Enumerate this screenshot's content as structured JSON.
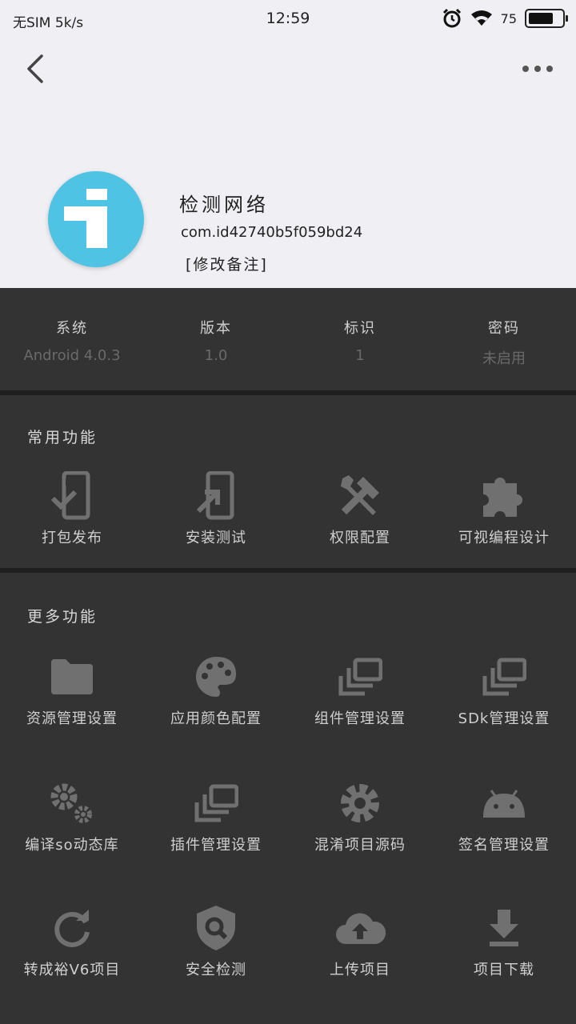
{
  "status_bar": {
    "carrier": "无SIM 5k/s",
    "time": "12:59",
    "battery_text": "75",
    "battery_level": 0.75
  },
  "header": {
    "back_icon": "back-arrow-icon",
    "more_icon": "more-horizontal-icon"
  },
  "app": {
    "icon": "info-icon",
    "icon_color": "#4fc3e3",
    "name": "检测网络",
    "package": "com.id42740b5f059bd24",
    "note_link": "[修改备注]"
  },
  "info": [
    {
      "label": "系统",
      "value": "Android 4.0.3"
    },
    {
      "label": "版本",
      "value": "1.0"
    },
    {
      "label": "标识",
      "value": "1"
    },
    {
      "label": "密码",
      "value": "未启用"
    }
  ],
  "common": {
    "title": "常用功能",
    "items": [
      {
        "label": "打包发布",
        "icon": "phone-check-icon"
      },
      {
        "label": "安装测试",
        "icon": "phone-install-icon"
      },
      {
        "label": "权限配置",
        "icon": "tools-icon"
      },
      {
        "label": "可视编程设计",
        "icon": "puzzle-icon"
      }
    ]
  },
  "more": {
    "title": "更多功能",
    "items": [
      {
        "label": "资源管理设置",
        "icon": "folder-icon"
      },
      {
        "label": "应用颜色配置",
        "icon": "palette-icon"
      },
      {
        "label": "组件管理设置",
        "icon": "stacked-windows-icon"
      },
      {
        "label": "SDk管理设置",
        "icon": "stacked-windows-icon"
      },
      {
        "label": "编译so动态库",
        "icon": "gears-icon"
      },
      {
        "label": "插件管理设置",
        "icon": "stacked-windows-icon"
      },
      {
        "label": "混淆项目源码",
        "icon": "gear-icon"
      },
      {
        "label": "签名管理设置",
        "icon": "android-icon"
      },
      {
        "label": "转成裕V6项目",
        "icon": "refresh-icon"
      },
      {
        "label": "安全检测",
        "icon": "shield-search-icon"
      },
      {
        "label": "上传项目",
        "icon": "cloud-upload-icon"
      },
      {
        "label": "项目下载",
        "icon": "download-icon"
      }
    ]
  }
}
